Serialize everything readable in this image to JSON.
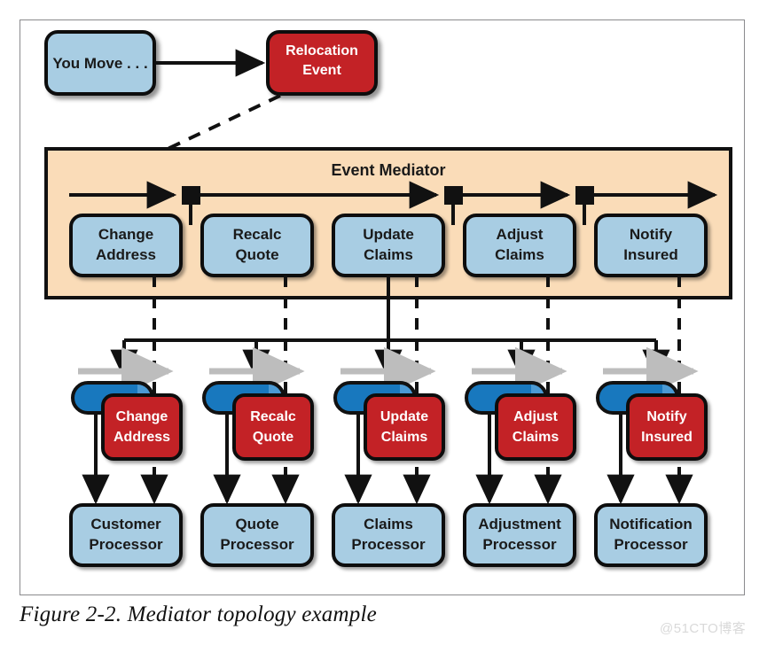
{
  "figure": {
    "caption": "Figure 2-2. Mediator topology example",
    "watermark": "@51CTO博客"
  },
  "colors": {
    "blue_fill": "#a8cde3",
    "blue_stroke": "#111111",
    "red_fill": "#c32026",
    "red_stroke": "#111111",
    "mediator_fill": "#fadcb8",
    "mediator_stroke": "#111111",
    "queue_blue": "#1878be",
    "queue_cap": "#4b9ad4",
    "grey_arrow": "#bdbdbd",
    "line": "#111111",
    "frame": "#8a8a8d"
  },
  "initiator": {
    "label": "You Move . . ."
  },
  "event": {
    "label_line1": "Relocation",
    "label_line2": "Event"
  },
  "mediator": {
    "title": "Event Mediator",
    "steps": [
      {
        "line1": "Change",
        "line2": "Address"
      },
      {
        "line1": "Recalc",
        "line2": "Quote"
      },
      {
        "line1": "Update",
        "line2": "Claims"
      },
      {
        "line1": "Adjust",
        "line2": "Claims"
      },
      {
        "line1": "Notify",
        "line2": "Insured"
      }
    ]
  },
  "channels": [
    {
      "line1": "Change",
      "line2": "Address"
    },
    {
      "line1": "Recalc",
      "line2": "Quote"
    },
    {
      "line1": "Update",
      "line2": "Claims"
    },
    {
      "line1": "Adjust",
      "line2": "Claims"
    },
    {
      "line1": "Notify",
      "line2": "Insured"
    }
  ],
  "processors": [
    {
      "line1": "Customer",
      "line2": "Processor"
    },
    {
      "line1": "Quote",
      "line2": "Processor"
    },
    {
      "line1": "Claims",
      "line2": "Processor"
    },
    {
      "line1": "Adjustment",
      "line2": "Processor"
    },
    {
      "line1": "Notification",
      "line2": "Processor"
    }
  ]
}
